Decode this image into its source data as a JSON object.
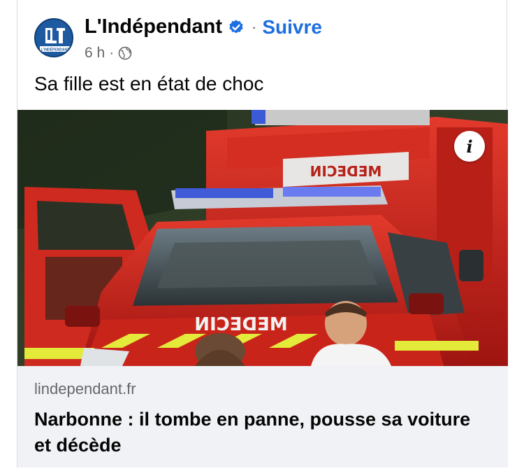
{
  "post": {
    "page_name": "L'Indépendant",
    "follow_label": "Suivre",
    "separator": "·",
    "time": "6 h",
    "caption": "Sa fille est en état de choc",
    "avatar_logo_text": "L'INDÉPENDANT",
    "verified_icon": "verified-badge-icon",
    "audience_icon": "globe-icon"
  },
  "media": {
    "info_label": "i",
    "vehicle_lettering": "MEDECIN"
  },
  "link": {
    "domain": "lindependant.fr",
    "headline": "Narbonne : il tombe en panne, pousse sa voiture et décède"
  },
  "colors": {
    "link_blue": "#1d6fe0",
    "secondary_text": "#65676b",
    "preview_bg": "#f0f2f5",
    "verified_blue": "#1d6fe0"
  }
}
